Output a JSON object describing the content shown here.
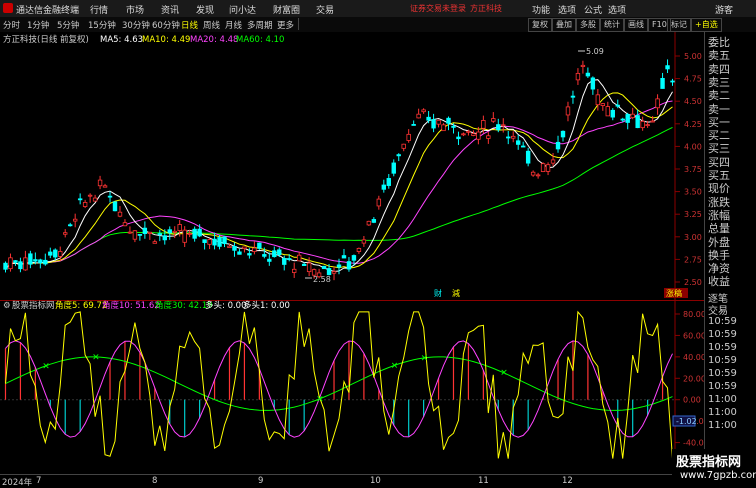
{
  "titlebar": {
    "app_title": "通达信金融终端",
    "menus": [
      "行情",
      "市场",
      "资讯",
      "发现",
      "问小达",
      "财富圈",
      "交易"
    ],
    "login_notice": "证券交易未登录",
    "broker": "方正科技",
    "right_menus": [
      "功能",
      "选项",
      "公式",
      "选项",
      "游客"
    ]
  },
  "toolbar": {
    "periods": [
      "分时",
      "1分钟",
      "5分钟",
      "15分钟",
      "30分钟",
      "60分钟",
      "日线",
      "周线",
      "月线",
      "多周期",
      "更多"
    ],
    "active_period": "日线",
    "right_buttons": [
      "复权",
      "叠加",
      "多股",
      "统计",
      "画线",
      "F10",
      "标记",
      "+自选"
    ]
  },
  "main": {
    "stock_title": "方正科技(日线 前复权)",
    "ma": [
      {
        "label": "MA5: 4.63",
        "color": "#ffffff"
      },
      {
        "label": "MA10: 4.49",
        "color": "#ffff00"
      },
      {
        "label": "MA20: 4.48",
        "color": "#ff44ff"
      },
      {
        "label": "MA60: 4.10",
        "color": "#00ff00"
      }
    ],
    "y_ticks": [
      "5.00",
      "4.75",
      "4.50",
      "4.25",
      "4.00",
      "3.75",
      "3.50",
      "3.25",
      "3.00",
      "2.75",
      "2.50"
    ],
    "high_label": "5.09",
    "low_label": "2.58",
    "badges": [
      "财",
      "減",
      "涨稿"
    ]
  },
  "indicator": {
    "title": "股票指标网",
    "values": [
      {
        "label": "角度5: 69.72",
        "color": "#ffff00"
      },
      {
        "label": "角度10: 51.62",
        "color": "#ff44ff"
      },
      {
        "label": "角度30: 42.19",
        "color": "#00ff00"
      },
      {
        "label": "多头: 0.00",
        "color": "#ffffff"
      },
      {
        "label": "多头1: 0.00",
        "color": "#ffffff"
      }
    ],
    "y_ticks": [
      "80.00",
      "60.00",
      "40.00",
      "20.00",
      "0.00",
      "-20.00",
      "-40.00",
      "-60.00"
    ],
    "cursor_value": "-1.02"
  },
  "bottom_axis": {
    "labels": [
      "2024年",
      "7",
      "8",
      "9",
      "10",
      "11",
      "12"
    ]
  },
  "right_panel": {
    "quote_labels": [
      "委比",
      "卖五",
      "卖四",
      "卖三",
      "卖二",
      "卖一",
      "买一",
      "买二",
      "买三",
      "买四",
      "买五",
      "现价",
      "涨跌",
      "涨幅",
      "总量",
      "外盘",
      "换手",
      "净资",
      "收益"
    ],
    "trades_title": "逐笔",
    "trades_subtitle": "交易",
    "trade_times": [
      "10:59",
      "10:59",
      "10:59",
      "10:59",
      "10:59",
      "10:59",
      "11:00",
      "11:00",
      "11:00"
    ]
  },
  "watermark": {
    "title": "股票指标网",
    "url": "www.7gpzb.com"
  },
  "colors": {
    "up": "#ff3333",
    "down": "#00ffff",
    "ma5": "#ffffff",
    "ma10": "#ffff00",
    "ma20": "#ff44ff",
    "ma60": "#00ff00"
  }
}
